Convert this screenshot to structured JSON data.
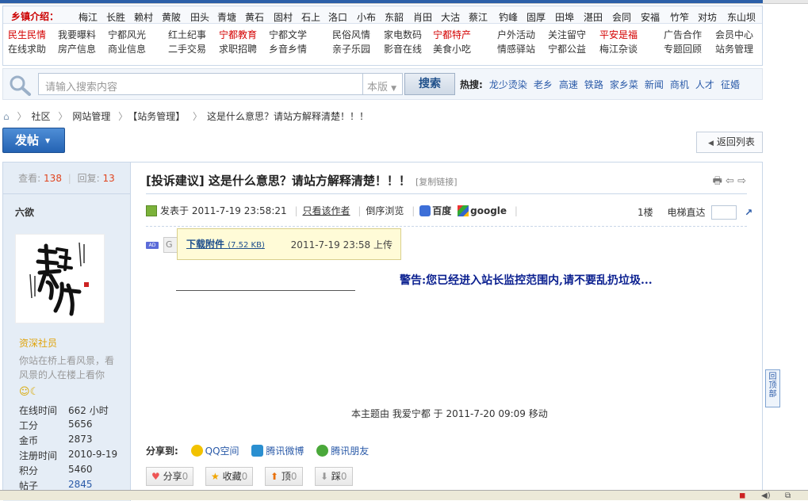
{
  "nav": {
    "label": "乡镇介绍：",
    "towns": [
      "梅江",
      "长胜",
      "赖村",
      "黄陂",
      "田头",
      "青塘",
      "黄石",
      "固村",
      "石上",
      "洛口",
      "小布",
      "东韶",
      "肖田",
      "大沽",
      "蔡江",
      "钓峰",
      "固厚",
      "田埠",
      "湛田",
      "会同",
      "安福",
      "竹笮",
      "对坊",
      "东山坝"
    ],
    "categories": [
      [
        "民生民情",
        "在线求助"
      ],
      [
        "我要曝料",
        "房产信息"
      ],
      [
        "宁都风光",
        "商业信息"
      ],
      [
        "红土纪事",
        "二手交易"
      ],
      [
        "宁都教育",
        "求职招聘"
      ],
      [
        "宁都文学",
        "乡音乡情"
      ],
      [
        "民俗风情",
        "亲子乐园"
      ],
      [
        "家电数码",
        "影音在线"
      ],
      [
        "宁都特产",
        "美食小吃"
      ],
      [
        "户外活动",
        "情感驿站"
      ],
      [
        "关注留守",
        "宁都公益"
      ],
      [
        "平安是福",
        "梅江杂谈"
      ],
      [
        "广告合作",
        "专题回顾"
      ],
      [
        "会员中心",
        "站务管理"
      ]
    ],
    "red_items": [
      "民生民情",
      "宁都教育",
      "宁都特产",
      "平安是福"
    ]
  },
  "search": {
    "placeholder": "请输入搜索内容",
    "scope": "本版",
    "button": "搜索",
    "hot_label": "热搜:",
    "hot": [
      "龙少烫染",
      "老乡",
      "高速",
      "铁路",
      "家乡菜",
      "新闻",
      "商机",
      "人才",
      "征婚"
    ]
  },
  "breadcrumb": {
    "items": [
      "社区",
      "网站管理",
      "【站务管理】",
      "这是什么意思？请站方解释清楚！！！"
    ]
  },
  "buttons": {
    "post": "发帖",
    "back": "返回列表"
  },
  "sidebar": {
    "views_label": "查看:",
    "views": "138",
    "replies_label": "回复:",
    "replies": "13",
    "username": "六欲",
    "group": "资深社员",
    "signature": "你站在桥上看风景，看风景的人在楼上看你",
    "stats": [
      {
        "k": "在线时间",
        "v": "662 小时"
      },
      {
        "k": "工分",
        "v": "5656"
      },
      {
        "k": "金币",
        "v": "2873"
      },
      {
        "k": "注册时间",
        "v": "2010-9-19"
      },
      {
        "k": "积分",
        "v": "5460"
      },
      {
        "k": "帖子",
        "v": "2845"
      }
    ]
  },
  "post": {
    "title": "[投诉建议] 这是什么意思？请站方解释清楚！！！",
    "copy_link": "[复制链接]",
    "posted": "发表于 2011-7-19 23:58:21",
    "only_author": "只看该作者",
    "reverse": "倒序浏览",
    "baidu": "百度",
    "google": "google",
    "floor": "1楼",
    "elevator": "电梯直达",
    "attach_link": "下载附件",
    "attach_size": "(7.52 KB)",
    "attach_time": "2011-7-19 23:58 上传",
    "warning": "警告:您已经进入站长监控范围内,请不要乱扔垃圾...",
    "moved_note": "本主题由 我爱宁都 于 2011-7-20 09:09 移动",
    "share_label": "分享到:",
    "share": [
      "QQ空间",
      "腾讯微博",
      "腾讯朋友"
    ],
    "actions": [
      {
        "label": "分享",
        "count": "0"
      },
      {
        "label": "收藏",
        "count": "0"
      },
      {
        "label": "顶",
        "count": "0"
      },
      {
        "label": "踩",
        "count": "0"
      }
    ]
  },
  "float": {
    "back_top": "回顶部"
  }
}
